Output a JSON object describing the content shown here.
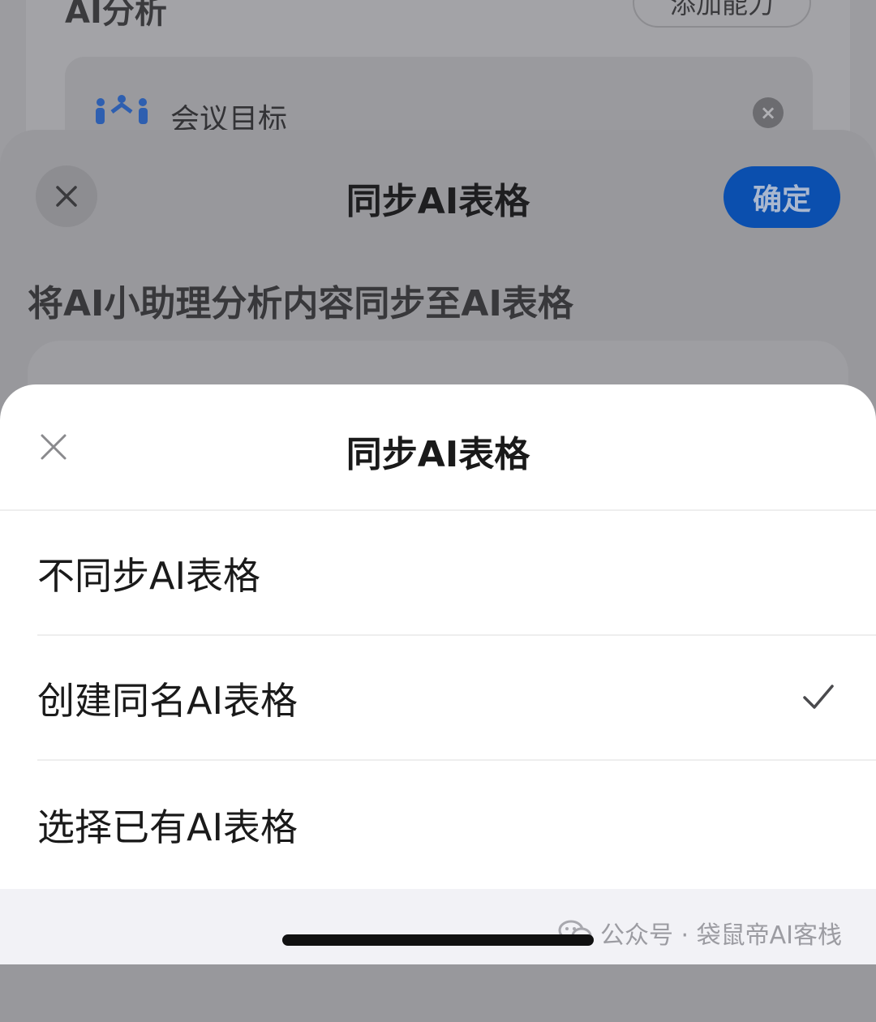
{
  "background": {
    "section_title": "AI分析",
    "add_button": "添加能力",
    "item_label": "会议目标",
    "item_remove": "×"
  },
  "mid_sheet": {
    "title": "同步AI表格",
    "confirm": "确定",
    "description": "将AI小助理分析内容同步至AI表格"
  },
  "sheet": {
    "title": "同步AI表格",
    "options": [
      {
        "label": "不同步AI表格",
        "selected": false
      },
      {
        "label": "创建同名AI表格",
        "selected": true
      },
      {
        "label": "选择已有AI表格",
        "selected": false
      }
    ]
  },
  "watermark": {
    "text": "公众号 · 袋鼠帝AI客栈"
  },
  "colors": {
    "accent": "#0b4fae",
    "overlay": "#9c9ca0",
    "sheet": "#ffffff"
  },
  "icons": [
    "close-icon",
    "check-icon",
    "meeting-people-icon",
    "wechat-icon",
    "remove-circle-icon"
  ]
}
